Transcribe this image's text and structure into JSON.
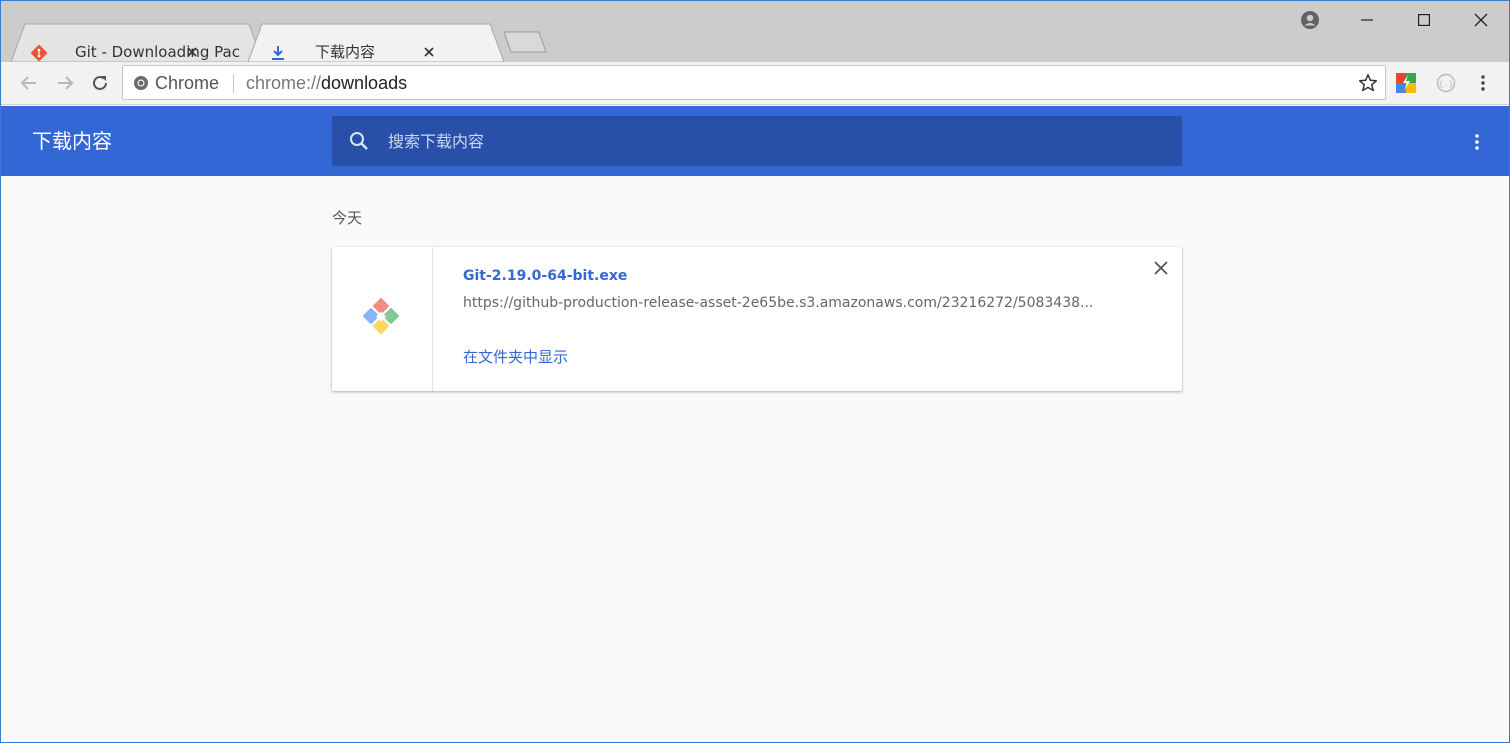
{
  "browser": {
    "tabs": [
      {
        "title": "Git - Downloading Package",
        "icon": "git-logo-icon",
        "active": false
      },
      {
        "title": "下载内容",
        "icon": "download-icon",
        "active": true
      }
    ],
    "omnibox": {
      "chip_label": "Chrome",
      "url_scheme": "chrome://",
      "url_host": "downloads"
    }
  },
  "downloads": {
    "title": "下载内容",
    "search_placeholder": "搜索下载内容",
    "date_group": "今天",
    "items": [
      {
        "file_name": "Git-2.19.0-64-bit.exe",
        "url": "https://github-production-release-asset-2e65be.s3.amazonaws.com/23216272/5083438...",
        "action": "在文件夹中显示"
      }
    ]
  },
  "colors": {
    "header_blue": "#3367d6",
    "search_bg": "#2850a8",
    "link_blue": "#3367d6",
    "git_orange": "#f05133"
  }
}
